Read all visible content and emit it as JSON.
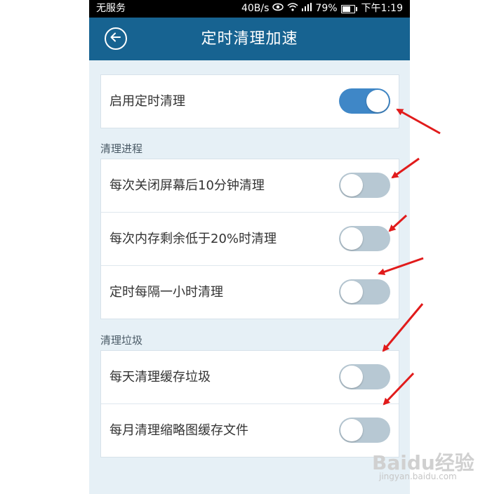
{
  "status_bar": {
    "carrier": "无服务",
    "speed": "40B/s",
    "battery": "79%",
    "time": "下午1:19"
  },
  "header": {
    "title": "定时清理加速"
  },
  "main": {
    "top_toggle": {
      "label": "启用定时清理",
      "on": true
    },
    "sections": [
      {
        "title": "清理进程",
        "items": [
          {
            "label": "每次关闭屏幕后10分钟清理",
            "on": false
          },
          {
            "label": "每次内存剩余低于20%时清理",
            "on": false
          },
          {
            "label": "定时每隔一小时清理",
            "on": false
          }
        ]
      },
      {
        "title": "清理垃圾",
        "items": [
          {
            "label": "每天清理缓存垃圾",
            "on": false
          },
          {
            "label": "每月清理缩略图缓存文件",
            "on": false
          }
        ]
      }
    ]
  },
  "watermark": {
    "brand": "Baidu经验",
    "url": "jingyan.baidu.com"
  },
  "colors": {
    "header": "#176391",
    "toggle_on": "#3f87c7",
    "toggle_off": "#b7c8d3",
    "arrow": "#e11b1b"
  },
  "icons": {
    "back": "back-arrow-icon",
    "eye": "eye-icon",
    "wifi": "wifi-icon",
    "signal": "signal-icon",
    "battery": "battery-icon"
  }
}
